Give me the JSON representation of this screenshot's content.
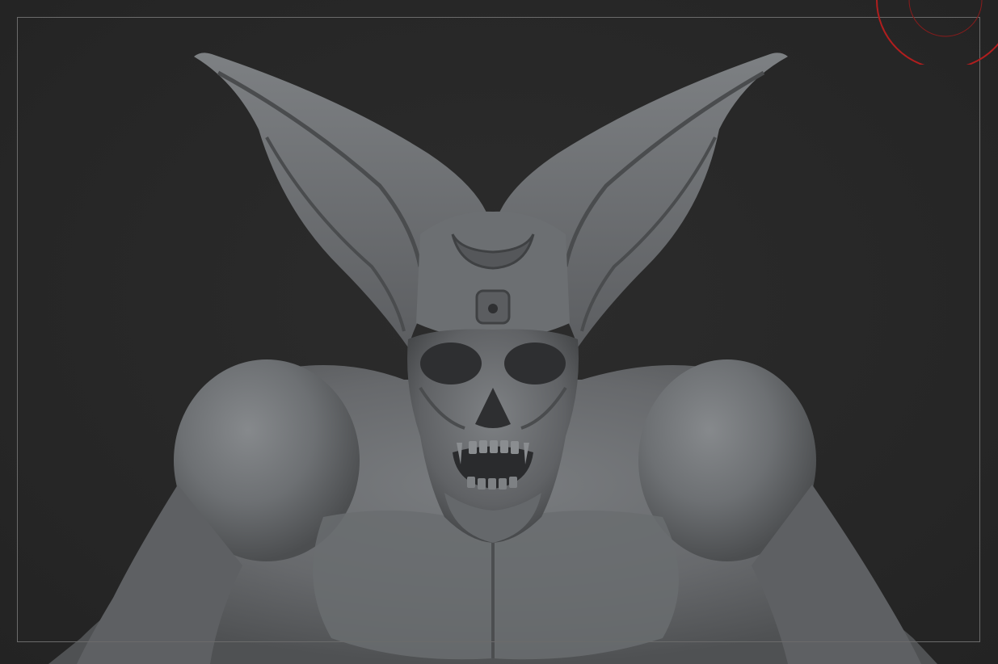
{
  "viewport": {
    "background_color": "#292929",
    "frame_color": "#6b6b6b",
    "model_color": "#6f7275"
  },
  "brush_cursor": {
    "icon": "brush-cursor-icon",
    "color": "#b01e1e"
  },
  "model": {
    "icon": "demon-skull-sculpt-icon"
  }
}
